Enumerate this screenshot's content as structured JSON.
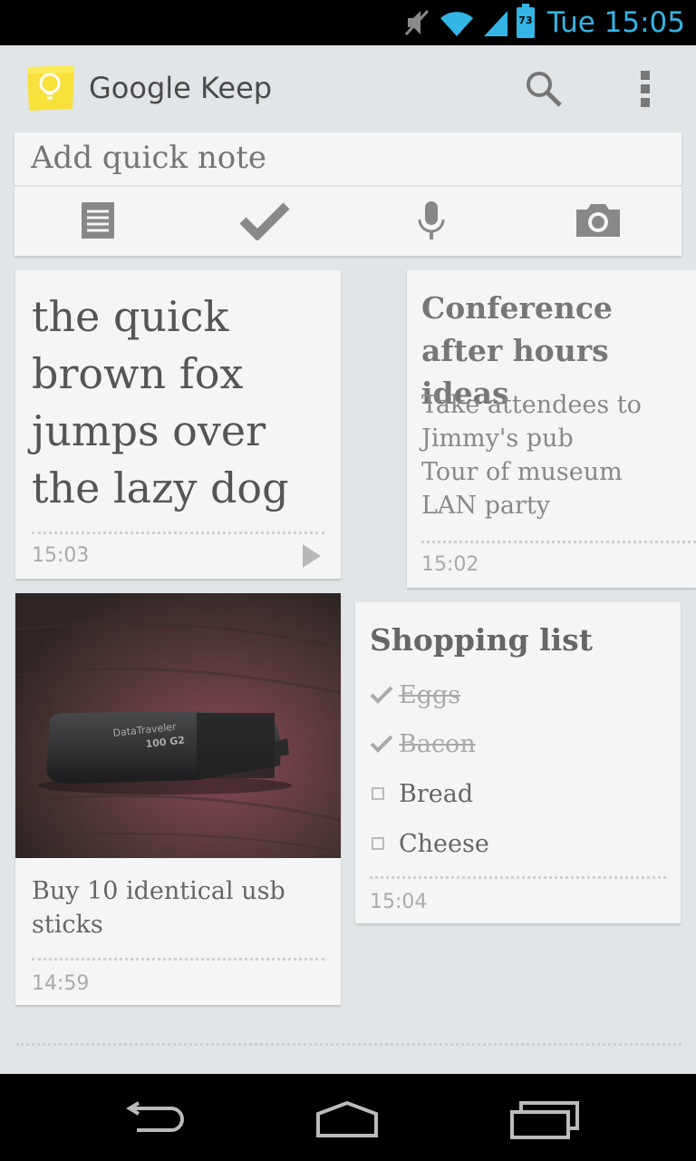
{
  "status_bar": {
    "battery_level": "73",
    "clock": "Tue 15:05",
    "accent_color": "#33b5e5",
    "icons": [
      "mute-icon",
      "wifi-icon",
      "signal-icon",
      "battery-icon"
    ]
  },
  "app": {
    "title": "Google Keep",
    "icon": "keep-bulb-icon",
    "actions": [
      "search-icon",
      "overflow-menu-icon"
    ]
  },
  "quick_note": {
    "placeholder": "Add quick note",
    "buttons": [
      "text-note-icon",
      "checklist-icon",
      "microphone-icon",
      "camera-icon"
    ]
  },
  "notes": {
    "text_note": {
      "body": "the quick brown fox jumps over the lazy dog",
      "time": "15:03",
      "has_audio": true
    },
    "conference": {
      "title": "Conference after hours ideas",
      "lines": [
        "Take attendees to",
        "Jimmy's pub",
        "Tour of museum",
        "LAN party"
      ],
      "time": "15:02"
    },
    "photo_note": {
      "caption": "Buy 10 identical usb sticks",
      "time": "14:59",
      "photo_label": "DataTraveler",
      "photo_model": "100 G2"
    },
    "shopping": {
      "title": "Shopping list",
      "items": [
        {
          "text": "Eggs",
          "checked": true
        },
        {
          "text": "Bacon",
          "checked": true
        },
        {
          "text": "Bread",
          "checked": false
        },
        {
          "text": "Cheese",
          "checked": false
        }
      ],
      "time": "15:04"
    }
  },
  "nav_bar": [
    "back-icon",
    "home-icon",
    "recent-apps-icon"
  ]
}
